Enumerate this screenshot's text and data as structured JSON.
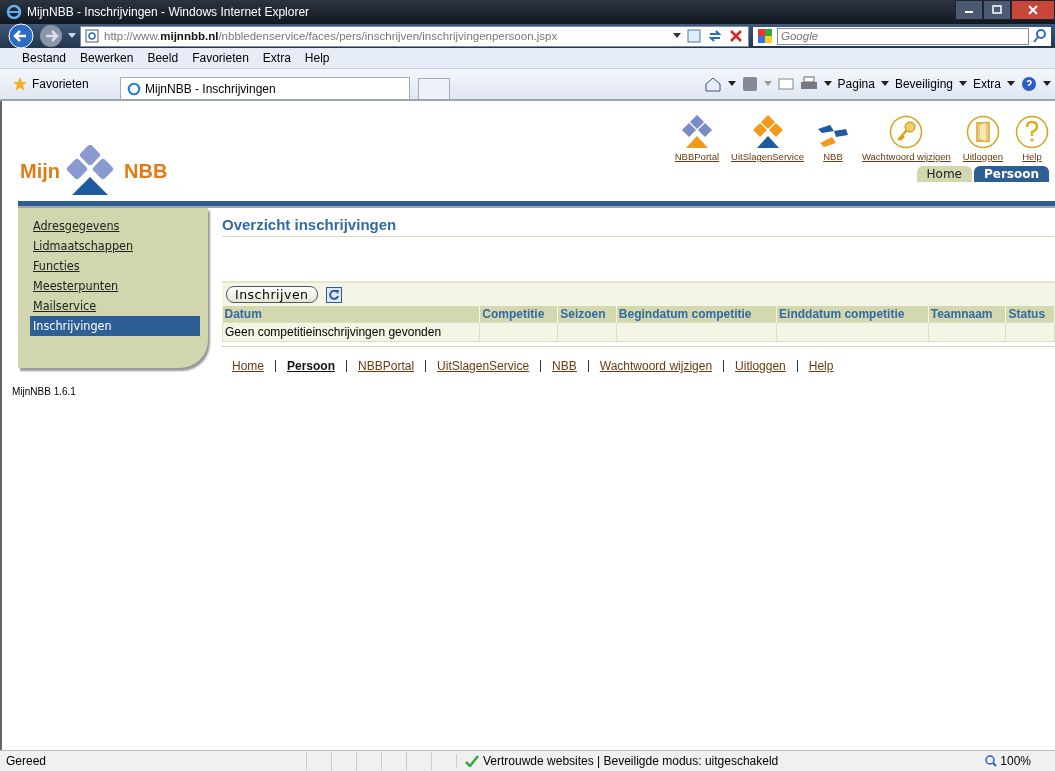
{
  "window": {
    "title": "MijnNBB - Inschrijvingen - Windows Internet Explorer"
  },
  "address_bar": {
    "url": "http://www.**mijnnbb.nl**/nbbledenservice/faces/pers/inschrijven/inschrijvingenpersoon.jspx"
  },
  "search": {
    "placeholder": "Google"
  },
  "menu_bar": [
    "Bestand",
    "Bewerken",
    "Beeld",
    "Favorieten",
    "Extra",
    "Help"
  ],
  "favorites_bar": {
    "favorites": "Favorieten",
    "tab": "MijnNBB - Inschrijvingen",
    "commands": [
      "Pagina",
      "Beveiliging",
      "Extra"
    ]
  },
  "site": {
    "logo_left": "Mijn",
    "logo_right": "NBB",
    "header_links": [
      {
        "label": "NBBPortal",
        "kind": "portal"
      },
      {
        "label": "UitSlagenService",
        "kind": "service"
      },
      {
        "label": "NBB",
        "kind": "nbb"
      },
      {
        "label": "Wachtwoord wijzigen",
        "kind": "key"
      },
      {
        "label": "Uitloggen",
        "kind": "door"
      },
      {
        "label": "Help",
        "kind": "help"
      }
    ],
    "tabs": [
      {
        "label": "Home",
        "selected": false
      },
      {
        "label": "Persoon",
        "selected": true
      }
    ],
    "sidebar": [
      {
        "label": "Adresgegevens",
        "selected": false
      },
      {
        "label": "Lidmaatschappen",
        "selected": false
      },
      {
        "label": "Functies",
        "selected": false
      },
      {
        "label": "Meesterpunten",
        "selected": false
      },
      {
        "label": "Mailservice",
        "selected": false
      },
      {
        "label": "Inschrijvingen",
        "selected": true
      }
    ],
    "version": "MijnNBB 1.6.1",
    "heading": "Overzicht inschrijvingen",
    "table": {
      "button": "Inschrijven",
      "columns": [
        "Datum",
        "Competitie",
        "Seizoen",
        "Begindatum competitie",
        "Einddatum competitie",
        "Teamnaam",
        "Status"
      ],
      "empty_message": "Geen competitieinschrijvingen gevonden"
    },
    "footer_links": [
      {
        "label": "Home",
        "selected": false
      },
      {
        "label": "Persoon",
        "selected": true
      },
      {
        "label": "NBBPortal",
        "selected": false
      },
      {
        "label": "UitSlagenService",
        "selected": false
      },
      {
        "label": "NBB",
        "selected": false
      },
      {
        "label": "Wachtwoord wijzigen",
        "selected": false
      },
      {
        "label": "Uitloggen",
        "selected": false
      },
      {
        "label": "Help",
        "selected": false
      }
    ]
  },
  "status_bar": {
    "status": "Gereed",
    "zone": "Vertrouwde websites | Beveiligde modus: uitgeschakeld",
    "zoom": "100%"
  }
}
